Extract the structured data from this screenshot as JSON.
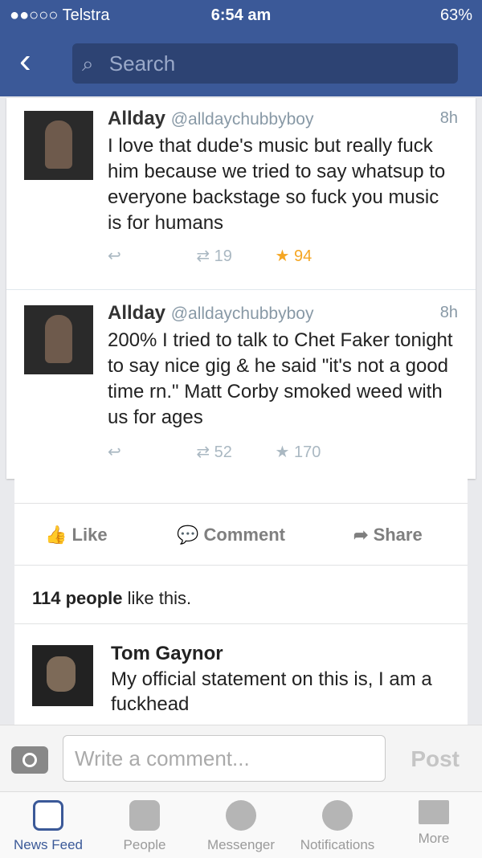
{
  "status_bar": {
    "carrier": "●●○○○ Telstra",
    "time": "6:54 am",
    "battery": "63%"
  },
  "nav": {
    "search_placeholder": "Search"
  },
  "tweets": [
    {
      "name": "Allday",
      "handle": "@alldaychubbyboy",
      "time": "8h",
      "text": "I love that dude's music but really fuck him because we tried to say whatsup to everyone backstage so fuck you music is for humans",
      "retweets": "19",
      "favorites": "94"
    },
    {
      "name": "Allday",
      "handle": "@alldaychubbyboy",
      "time": "8h",
      "text": "200% I tried to talk to Chet Faker tonight to say nice gig & he said \"it's not a good time rn.\" Matt Corby smoked weed with us for ages",
      "retweets": "52",
      "favorites": "170"
    }
  ],
  "post_actions": {
    "like": "Like",
    "comment": "Comment",
    "share": "Share"
  },
  "likes": {
    "count": "114 people",
    "suffix": " like this."
  },
  "comment": {
    "name": "Tom Gaynor",
    "text": "My official statement on this is, I am a fuckhead"
  },
  "composer": {
    "placeholder": "Write a comment...",
    "post": "Post"
  },
  "tabs": [
    {
      "label": "News Feed"
    },
    {
      "label": "People"
    },
    {
      "label": "Messenger"
    },
    {
      "label": "Notifications"
    },
    {
      "label": "More"
    }
  ]
}
